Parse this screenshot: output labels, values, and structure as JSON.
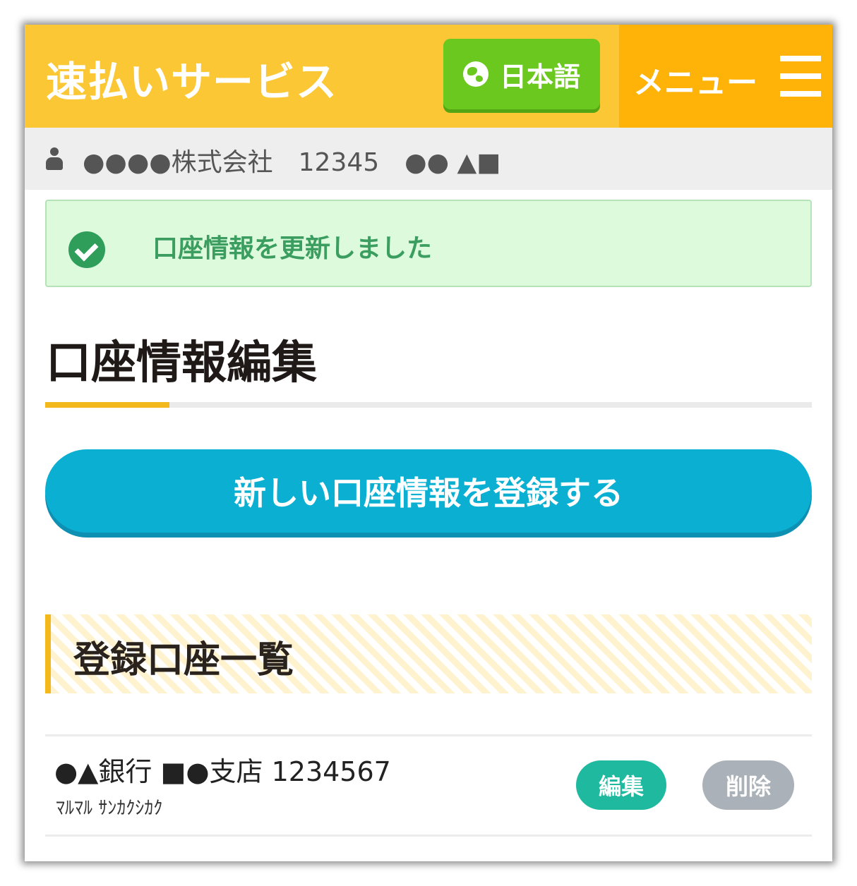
{
  "header": {
    "brand": "速払いサービス",
    "language_button": "日本語",
    "language_icon": "globe-icon",
    "menu_label": "メニュー",
    "menu_icon": "hamburger-icon",
    "colors": {
      "header_bg": "#fbc734",
      "menu_bg": "#ffb208",
      "language_bg": "#6bc81f"
    }
  },
  "user_bar": {
    "icon": "user-icon",
    "text": "●●●●株式会社　12345　●● ▲■"
  },
  "alert": {
    "icon": "check-circle-icon",
    "message": "口座情報を更新しました"
  },
  "page": {
    "title": "口座情報編集",
    "register_button": "新しい口座情報を登録する",
    "register_color": "#0aafd2"
  },
  "accounts_section": {
    "title": "登録口座一覧",
    "items": [
      {
        "name": "●▲銀行 ■●支店 1234567",
        "holder_kana": "ﾏﾙﾏﾙ ｻﾝｶｸｼｶｸ",
        "edit_label": "編集",
        "delete_label": "削除"
      }
    ]
  }
}
